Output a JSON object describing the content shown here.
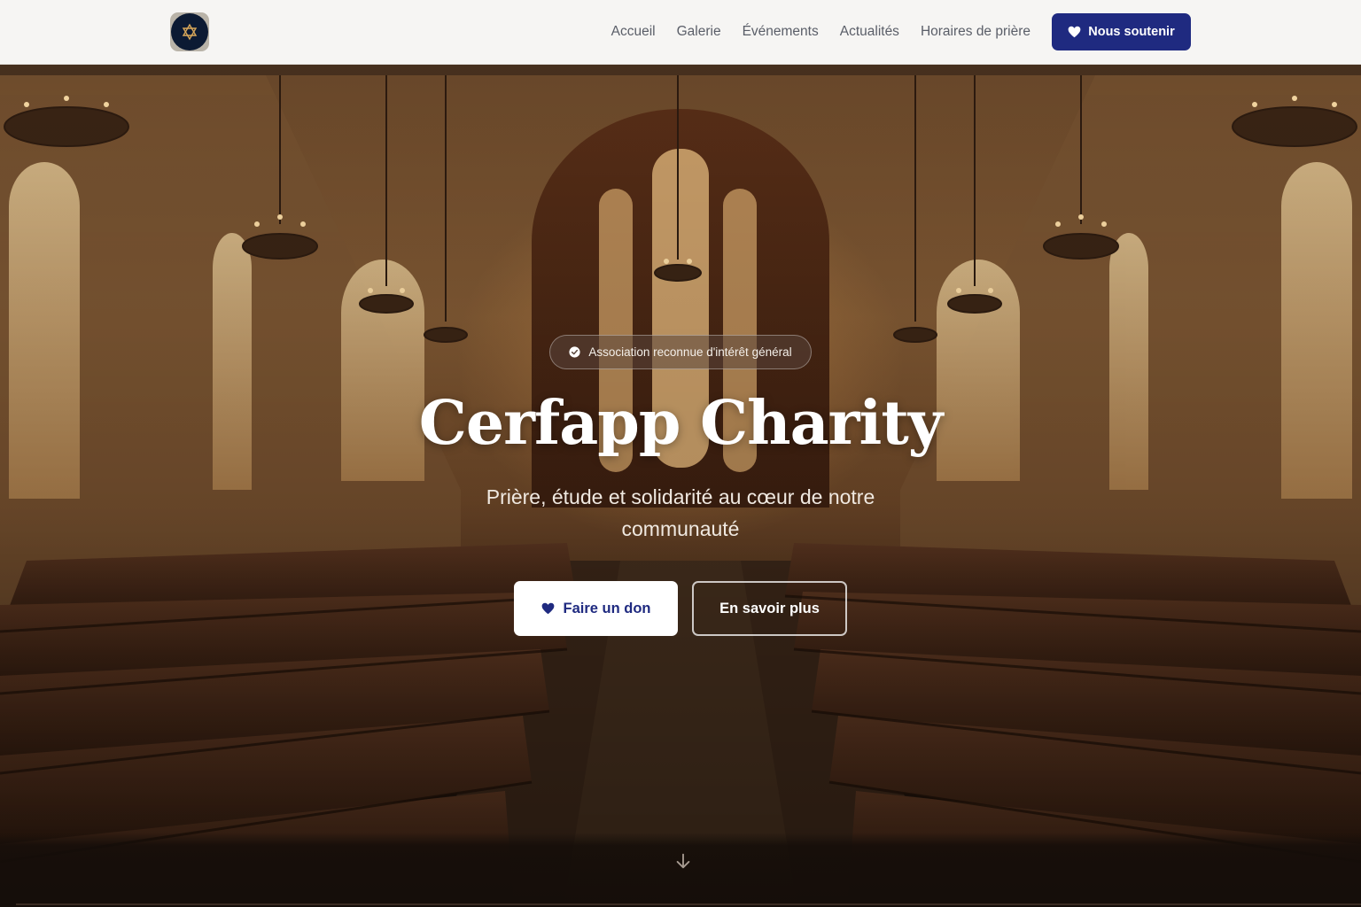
{
  "header": {
    "logo_icon": "star-of-david-icon",
    "nav": [
      {
        "label": "Accueil"
      },
      {
        "label": "Galerie"
      },
      {
        "label": "Événements"
      },
      {
        "label": "Actualités"
      },
      {
        "label": "Horaires de prière"
      }
    ],
    "support_button": {
      "label": "Nous soutenir",
      "icon": "heart-icon"
    }
  },
  "hero": {
    "badge": {
      "label": "Association reconnue d'intérêt général",
      "icon": "check-badge-icon"
    },
    "title": "Cerfapp Charity",
    "subtitle": "Prière, étude et solidarité au cœur de notre communauté",
    "donate_button": {
      "label": "Faire un don",
      "icon": "heart-icon"
    },
    "more_button": {
      "label": "En savoir plus"
    },
    "scroll_icon": "arrow-down-icon"
  },
  "colors": {
    "brand": "#1f2a80",
    "nav_background": "#f6f5f3",
    "nav_text": "#5a5e68"
  }
}
